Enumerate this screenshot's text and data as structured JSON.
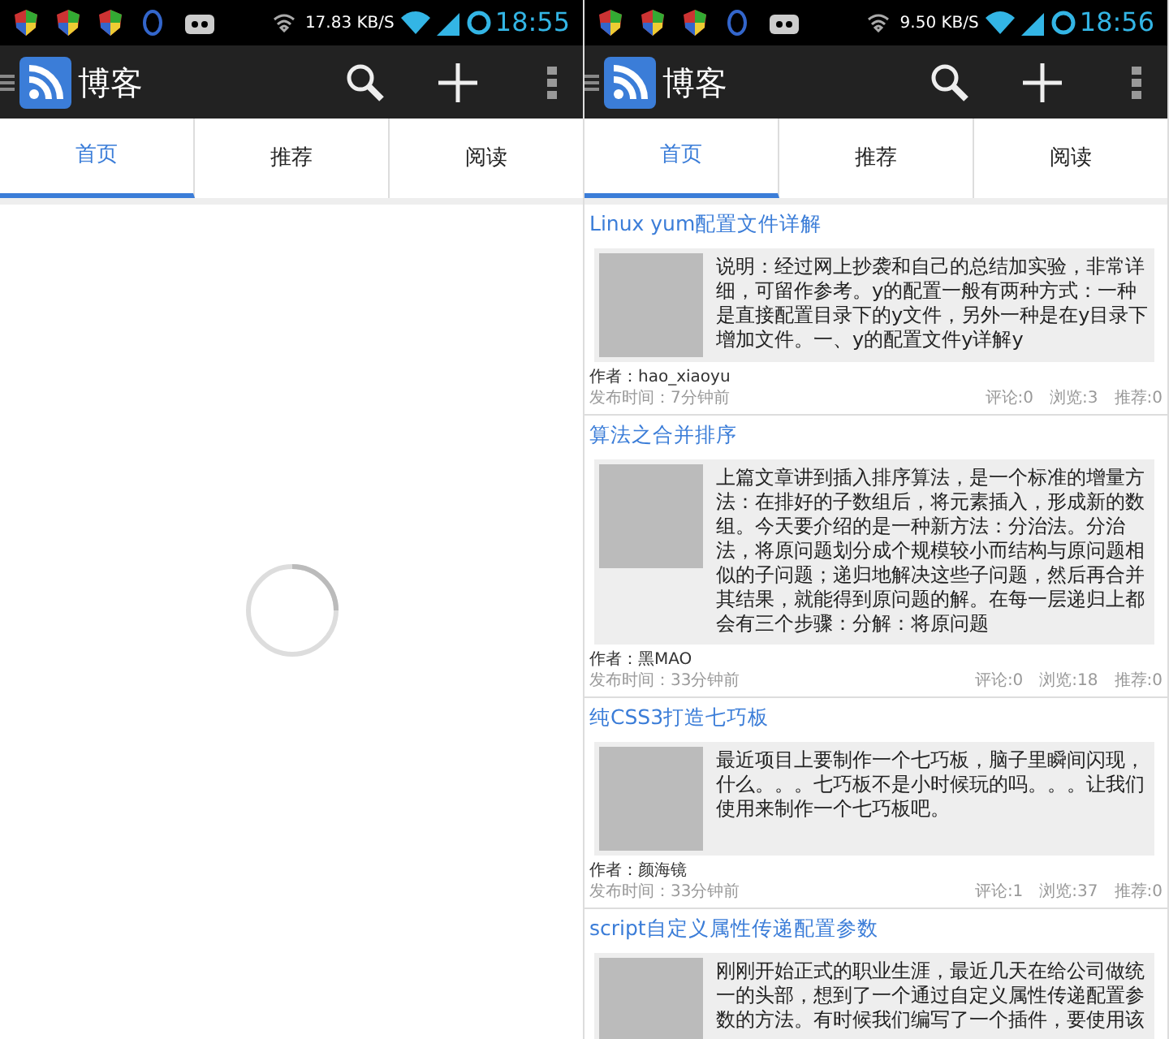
{
  "phones": [
    {
      "status_bar": {
        "speed": "17.83 KB/S",
        "time": "18:55"
      },
      "app_bar": {
        "title": "博客"
      },
      "tabs": [
        {
          "label": "首页",
          "selected": true
        },
        {
          "label": "推荐",
          "selected": false
        },
        {
          "label": "阅读",
          "selected": false
        }
      ],
      "loading": true
    },
    {
      "status_bar": {
        "speed": "9.50 KB/S",
        "time": "18:56"
      },
      "app_bar": {
        "title": "博客"
      },
      "tabs": [
        {
          "label": "首页",
          "selected": true
        },
        {
          "label": "推荐",
          "selected": false
        },
        {
          "label": "阅读",
          "selected": false
        }
      ],
      "loading": false,
      "articles": [
        {
          "title": "Linux yum配置文件详解",
          "summary": "说明：经过网上抄袭和自己的总结加实验，非常详细，可留作参考。y的配置一般有两种方式：一种是直接配置目录下的y文件，另外一种是在y目录下增加文件。一、y的配置文件y详解y",
          "author": "作者：hao_xiaoyu",
          "time": "发布时间：7分钟前",
          "comments": "评论:0",
          "views": "浏览:3",
          "recommends": "推荐:0"
        },
        {
          "title": "算法之合并排序",
          "summary": "上篇文章讲到插入排序算法，是一个标准的增量方法：在排好的子数组后，将元素插入，形成新的数组。今天要介绍的是一种新方法：分治法。分治法，将原问题划分成个规模较小而结构与原问题相似的子问题；递归地解决这些子问题，然后再合并其结果，就能得到原问题的解。在每一层递归上都会有三个步骤：分解：将原问题",
          "author": "作者：黑MAO",
          "time": "发布时间：33分钟前",
          "comments": "评论:0",
          "views": "浏览:18",
          "recommends": "推荐:0"
        },
        {
          "title": "纯CSS3打造七巧板",
          "summary": "最近项目上要制作一个七巧板，脑子里瞬间闪现，什么。。。七巧板不是小时候玩的吗。。。让我们使用来制作一个七巧板吧。",
          "author": "作者：颜海镜",
          "time": "发布时间：33分钟前",
          "comments": "评论:1",
          "views": "浏览:37",
          "recommends": "推荐:0"
        },
        {
          "title": "script自定义属性传递配置参数",
          "summary": "刚刚开始正式的职业生涯，最近几天在给公司做统一的头部，想到了一个通过自定义属性传递配置参数的方法。有时候我们编写了一个插件，要使用该"
        }
      ]
    }
  ]
}
